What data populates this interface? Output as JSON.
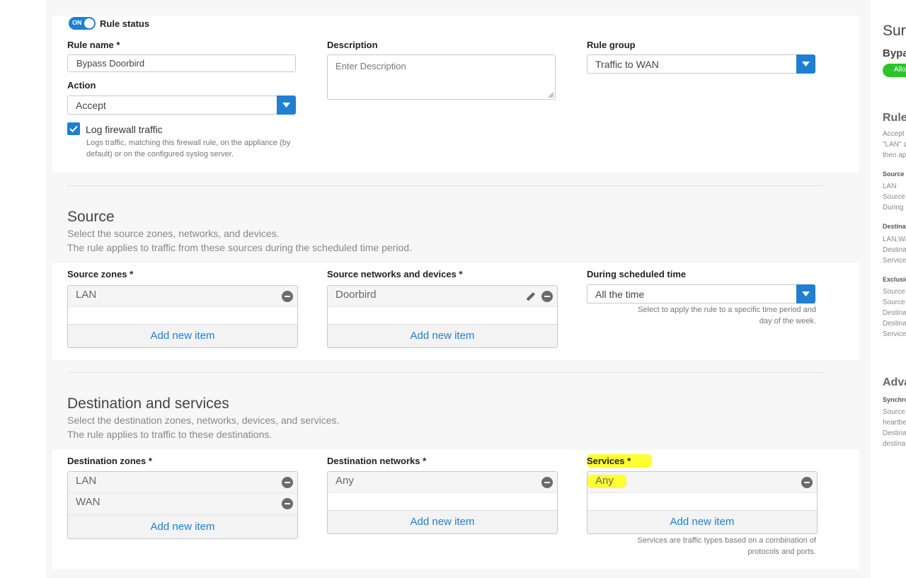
{
  "rule": {
    "status_toggle": "ON",
    "status_label": "Rule status",
    "name_label": "Rule name *",
    "name_value": "Bypass Doorbird",
    "description_label": "Description",
    "description_placeholder": "Enter Description",
    "group_label": "Rule group",
    "group_value": "Traffic to WAN",
    "action_label": "Action",
    "action_value": "Accept",
    "log_label": "Log firewall traffic",
    "log_hint_line1": "Logs traffic, matching this firewall rule, on the appliance (by",
    "log_hint_line2": "default) or on the configured syslog server."
  },
  "source": {
    "title": "Source",
    "desc_line1": "Select the source zones, networks, and devices.",
    "desc_line2": "The rule applies to traffic from these sources during the scheduled time period.",
    "zones_label": "Source zones *",
    "zones": [
      "LAN"
    ],
    "networks_label": "Source networks and devices *",
    "networks": [
      "Doorbird"
    ],
    "schedule_label": "During scheduled time",
    "schedule_value": "All the time",
    "schedule_hint_line1": "Select to apply the rule to a specific time period and",
    "schedule_hint_line2": "day of the week.",
    "add_item": "Add new item"
  },
  "destination": {
    "title": "Destination and services",
    "desc_line1": "Select the destination zones, networks, devices, and services.",
    "desc_line2": "The rule applies to traffic to these destinations.",
    "zones_label": "Destination zones *",
    "zones": [
      "LAN",
      "WAN"
    ],
    "networks_label": "Destination networks *",
    "networks": [
      "Any"
    ],
    "services_label": "Services *",
    "services": [
      "Any"
    ],
    "services_hint_line1": "Services are traffic types based on a combination of",
    "services_hint_line2": "protocols and ports.",
    "add_item": "Add new item"
  },
  "summary_panel": {
    "title": "Sur",
    "rule_name": "Bypa",
    "badge": "Allo",
    "rule_heading": "Rule",
    "rule_lines": [
      "Accept",
      "\"LAN\" z",
      "then ap"
    ],
    "source_heading": "Source a",
    "source_lines": [
      "LAN",
      "Source",
      "During"
    ],
    "dest_heading": "Destinat",
    "dest_lines": [
      "LAN,WA",
      "Destina",
      "Service"
    ],
    "excl_heading": "Exclusio",
    "excl_lines": [
      "Source",
      "Source",
      "Destina",
      "Destina",
      "Service"
    ],
    "adv_heading": "Adva",
    "sync_heading": "Synchro",
    "sync_lines": [
      "Source",
      "heartbe",
      "Destina",
      "destina"
    ]
  },
  "colors": {
    "accent": "#1e7fd3",
    "highlight": "#ffff33",
    "badge_green": "#2bc42b"
  }
}
